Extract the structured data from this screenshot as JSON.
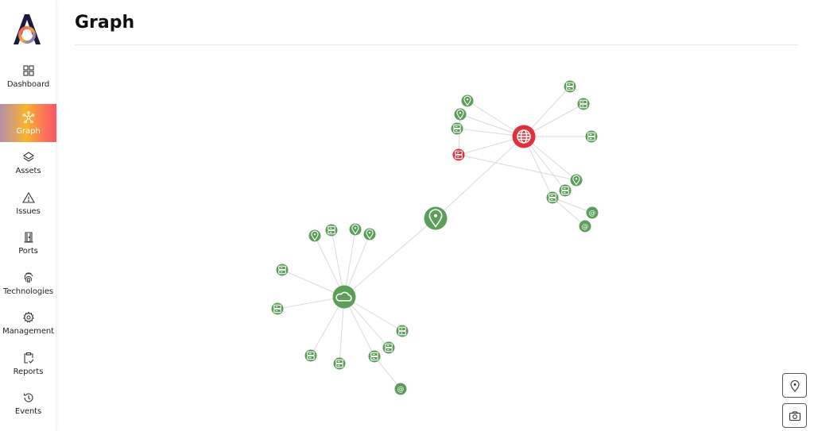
{
  "app": {
    "logo_icon": "app-logo-a-ring",
    "page_title": "Graph"
  },
  "sidebar": {
    "active": "Graph",
    "items": [
      {
        "label": "Dashboard",
        "icon": "dashboard-grid-icon"
      },
      {
        "label": "Graph",
        "icon": "graph-nodes-icon"
      },
      {
        "label": "Assets",
        "icon": "layers-icon"
      },
      {
        "label": "Issues",
        "icon": "warning-triangle-icon"
      },
      {
        "label": "Ports",
        "icon": "door-icon"
      },
      {
        "label": "Technologies",
        "icon": "fingerprint-icon"
      },
      {
        "label": "Management",
        "icon": "gear-icon"
      },
      {
        "label": "Reports",
        "icon": "clipboard-check-icon"
      },
      {
        "label": "Events",
        "icon": "history-icon"
      }
    ]
  },
  "toolbar": {
    "buttons": [
      {
        "name": "locate-button",
        "icon": "map-pin-icon"
      },
      {
        "name": "screenshot-button",
        "icon": "camera-icon"
      }
    ]
  },
  "graph": {
    "colors": {
      "ok": "#5a9e57",
      "alert": "#e0303c",
      "edge": "#d9d9d9",
      "icon": "#ffffff"
    },
    "nodes": [
      {
        "id": "hub-location",
        "type": "location",
        "status": "ok",
        "size": "large"
      },
      {
        "id": "cloud",
        "type": "cloud",
        "status": "ok",
        "size": "large"
      },
      {
        "id": "domain",
        "type": "globe",
        "status": "alert",
        "size": "large"
      },
      {
        "id": "d-pin-1",
        "type": "location",
        "status": "ok"
      },
      {
        "id": "d-pin-2",
        "type": "location",
        "status": "ok"
      },
      {
        "id": "d-srv-1",
        "type": "server",
        "status": "ok"
      },
      {
        "id": "d-srv-alert",
        "type": "server",
        "status": "alert"
      },
      {
        "id": "d-srv-2",
        "type": "server",
        "status": "ok"
      },
      {
        "id": "d-srv-3",
        "type": "server",
        "status": "ok"
      },
      {
        "id": "d-srv-4",
        "type": "server",
        "status": "ok"
      },
      {
        "id": "d-pin-3",
        "type": "location",
        "status": "ok"
      },
      {
        "id": "d-srv-5",
        "type": "server",
        "status": "ok"
      },
      {
        "id": "d-srv-6",
        "type": "server",
        "status": "ok"
      },
      {
        "id": "d-email-1",
        "type": "email",
        "status": "ok"
      },
      {
        "id": "d-email-2",
        "type": "email",
        "status": "ok"
      },
      {
        "id": "c-pin-1",
        "type": "location",
        "status": "ok"
      },
      {
        "id": "c-srv-1",
        "type": "server",
        "status": "ok"
      },
      {
        "id": "c-pin-2",
        "type": "location",
        "status": "ok"
      },
      {
        "id": "c-pin-3",
        "type": "location",
        "status": "ok"
      },
      {
        "id": "c-srv-2",
        "type": "server",
        "status": "ok"
      },
      {
        "id": "c-srv-3",
        "type": "server",
        "status": "ok"
      },
      {
        "id": "c-srv-4",
        "type": "server",
        "status": "ok"
      },
      {
        "id": "c-srv-5",
        "type": "server",
        "status": "ok"
      },
      {
        "id": "c-srv-6",
        "type": "server",
        "status": "ok"
      },
      {
        "id": "c-srv-7",
        "type": "server",
        "status": "ok"
      },
      {
        "id": "c-srv-8",
        "type": "server",
        "status": "ok"
      },
      {
        "id": "c-email-1",
        "type": "email",
        "status": "ok"
      }
    ],
    "edges": [
      [
        "hub-location",
        "domain"
      ],
      [
        "hub-location",
        "cloud"
      ],
      [
        "domain",
        "d-pin-1"
      ],
      [
        "domain",
        "d-pin-2"
      ],
      [
        "domain",
        "d-srv-1"
      ],
      [
        "domain",
        "d-srv-alert"
      ],
      [
        "domain",
        "d-srv-2"
      ],
      [
        "domain",
        "d-srv-3"
      ],
      [
        "domain",
        "d-srv-4"
      ],
      [
        "domain",
        "d-pin-3"
      ],
      [
        "domain",
        "d-srv-5"
      ],
      [
        "domain",
        "d-srv-6"
      ],
      [
        "d-pin-2",
        "d-srv-alert"
      ],
      [
        "d-srv-alert",
        "d-pin-3"
      ],
      [
        "d-srv-6",
        "d-email-1"
      ],
      [
        "d-srv-6",
        "d-email-2"
      ],
      [
        "cloud",
        "c-pin-1"
      ],
      [
        "cloud",
        "c-srv-1"
      ],
      [
        "cloud",
        "c-pin-2"
      ],
      [
        "cloud",
        "c-pin-3"
      ],
      [
        "cloud",
        "c-srv-2"
      ],
      [
        "cloud",
        "c-srv-3"
      ],
      [
        "cloud",
        "c-srv-4"
      ],
      [
        "cloud",
        "c-srv-5"
      ],
      [
        "cloud",
        "c-srv-6"
      ],
      [
        "cloud",
        "c-srv-7"
      ],
      [
        "cloud",
        "c-srv-8"
      ],
      [
        "c-srv-7",
        "c-email-1"
      ]
    ]
  }
}
